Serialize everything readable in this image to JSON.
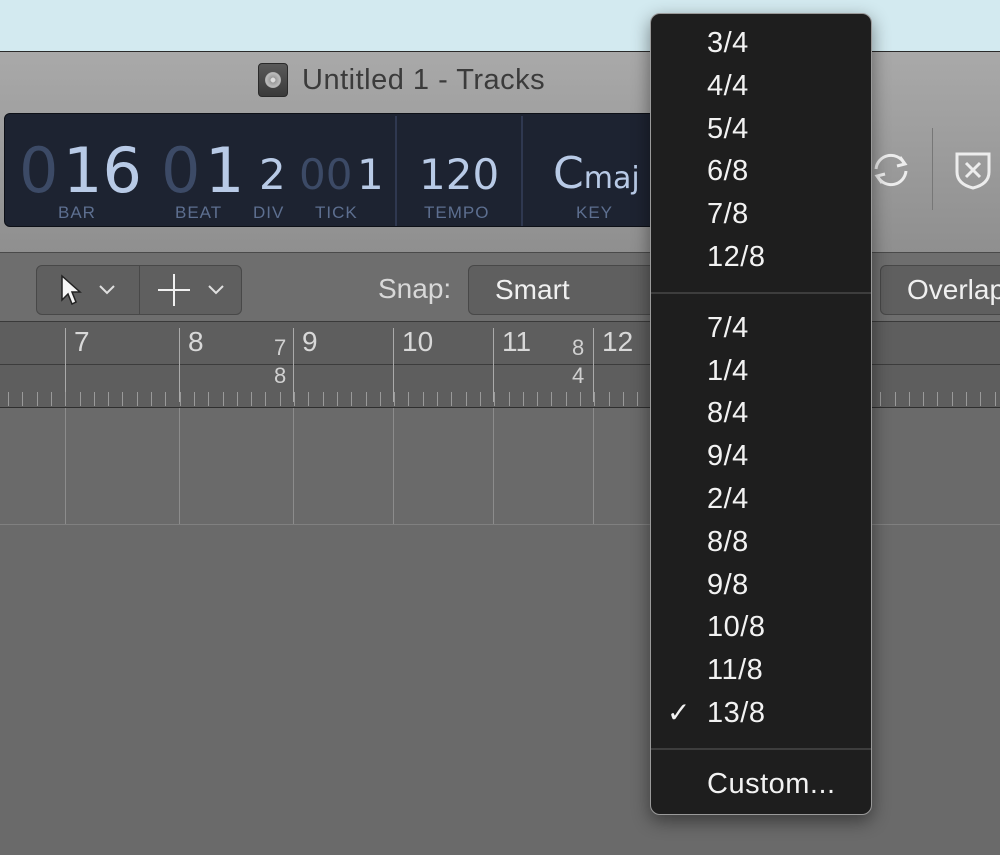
{
  "window": {
    "title": "Untitled 1 - Tracks",
    "project_icon": "project-file-icon"
  },
  "lcd": {
    "bar": {
      "dim": "0",
      "value": "16",
      "label": "BAR"
    },
    "beat": {
      "dim": "0",
      "value": "1",
      "label": "BEAT"
    },
    "div": {
      "value": "2",
      "label": "DIV"
    },
    "tick": {
      "dim": "00",
      "value": "1",
      "label": "TICK"
    },
    "tempo": {
      "value": "120",
      "label": "TEMPO"
    },
    "key": {
      "value": "C",
      "suffix": "maj",
      "label": "KEY"
    }
  },
  "titlebar_buttons": {
    "cycle": "cycle-icon",
    "close": "close-shield-icon"
  },
  "toolbar": {
    "pointer_tool": "pointer-tool-icon",
    "marquee_tool": "crosshair-tool-icon",
    "snap_label": "Snap:",
    "snap_value": "Smart",
    "overlap_value": "Overlap"
  },
  "ruler": {
    "bars": [
      "7",
      "8",
      "9",
      "10",
      "11",
      "12"
    ],
    "signature_markers": [
      {
        "top": "7",
        "bottom": "8"
      },
      {
        "top": "8",
        "bottom": "4"
      }
    ]
  },
  "menu": {
    "group1": [
      "3/4",
      "4/4",
      "5/4",
      "6/8",
      "7/8",
      "12/8"
    ],
    "group2": [
      "7/4",
      "1/4",
      "8/4",
      "9/4",
      "2/4",
      "8/8",
      "9/8",
      "10/8",
      "11/8",
      "13/8"
    ],
    "checked": "13/8",
    "check_mark": "✓",
    "custom": "Custom..."
  },
  "colors": {
    "lcd_background": "#1d2331",
    "lcd_text": "#b8cae6",
    "menu_background": "#1e1e1e"
  }
}
